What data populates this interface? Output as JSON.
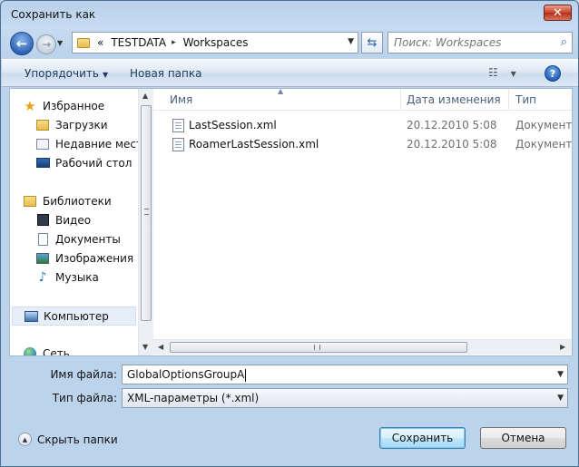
{
  "window": {
    "title": "Сохранить как",
    "close_label": "✕"
  },
  "nav": {
    "back_label": "←",
    "forward_label": "→",
    "breadcrumb_prefix": "«",
    "breadcrumb": [
      "TESTDATA",
      "Workspaces"
    ],
    "breadcrumb_sep": "▸",
    "search_placeholder": "Поиск: Workspaces"
  },
  "toolbar": {
    "organize_label": "Упорядочить",
    "new_folder_label": "Новая папка",
    "help_label": "?"
  },
  "sidebar": {
    "items": [
      {
        "label": "Избранное",
        "icon": "star-icon"
      },
      {
        "label": "Загрузки",
        "icon": "downloads-folder-icon"
      },
      {
        "label": "Недавние места",
        "icon": "recent-places-icon"
      },
      {
        "label": "Рабочий стол",
        "icon": "desktop-icon"
      },
      {
        "label": "Библиотеки",
        "icon": "libraries-icon"
      },
      {
        "label": "Видео",
        "icon": "video-icon"
      },
      {
        "label": "Документы",
        "icon": "documents-icon"
      },
      {
        "label": "Изображения",
        "icon": "pictures-icon"
      },
      {
        "label": "Музыка",
        "icon": "music-icon"
      },
      {
        "label": "Компьютер",
        "icon": "computer-icon"
      },
      {
        "label": "Сеть",
        "icon": "network-icon"
      }
    ]
  },
  "file_list": {
    "columns": [
      "Имя",
      "Дата изменения",
      "Тип"
    ],
    "rows": [
      {
        "name": "LastSession.xml",
        "date": "20.12.2010 5:08",
        "type": "Документ X"
      },
      {
        "name": "RoamerLastSession.xml",
        "date": "20.12.2010 5:08",
        "type": "Документ X"
      }
    ]
  },
  "form": {
    "filename_label": "Имя файла:",
    "filename_value": "GlobalOptionsGroupA",
    "filetype_label": "Тип файла:",
    "filetype_value": "XML-параметры (*.xml)"
  },
  "footer": {
    "hide_folders_label": "Скрыть папки",
    "save_label": "Сохранить",
    "cancel_label": "Отмена"
  },
  "colors": {
    "accent": "#3c7fb1",
    "window_frame": "#bcd3ec",
    "close_button": "#c8452f"
  }
}
